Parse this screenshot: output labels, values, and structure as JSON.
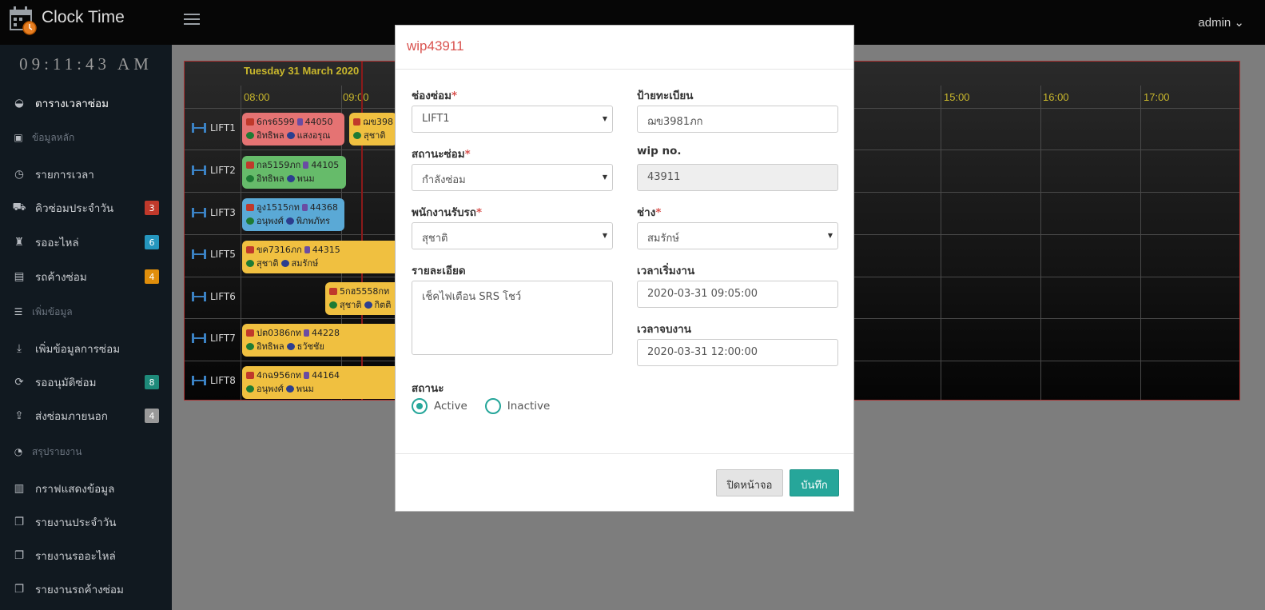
{
  "app": {
    "title": "Clock Time",
    "user": "admin ⌄"
  },
  "clock": "09:11:43 AM",
  "sidebar": {
    "items": [
      {
        "label": "ตารางเวลาซ่อม",
        "type": "item",
        "active": true
      },
      {
        "label": "ข้อมูลหลัก",
        "type": "header"
      },
      {
        "label": "รายการเวลา",
        "type": "item"
      },
      {
        "label": "คิวซ่อมประจำวัน",
        "type": "item",
        "badge": "3",
        "badge_color": "#c0392b"
      },
      {
        "label": "รออะไหล่",
        "type": "item",
        "badge": "6",
        "badge_color": "#2596be"
      },
      {
        "label": "รถค้างซ่อม",
        "type": "item",
        "badge": "4",
        "badge_color": "#e08e0b"
      },
      {
        "label": "เพิ่มข้อมูล",
        "type": "header"
      },
      {
        "label": "เพิ่มข้อมูลการซ่อม",
        "type": "item"
      },
      {
        "label": "รออนุมัติซ่อม",
        "type": "item",
        "badge": "8",
        "badge_color": "#1e8a7a"
      },
      {
        "label": "ส่งซ่อมภายนอก",
        "type": "item",
        "badge": "4",
        "badge_color": "#999999"
      },
      {
        "label": "สรุปรายงาน",
        "type": "header"
      },
      {
        "label": "กราฟแสดงข้อมูล",
        "type": "item"
      },
      {
        "label": "รายงานประจำวัน",
        "type": "item"
      },
      {
        "label": "รายงานรออะไหล่",
        "type": "item"
      },
      {
        "label": "รายงานรถค้างซ่อม",
        "type": "item"
      }
    ]
  },
  "schedule": {
    "date": "Tuesday 31 March 2020",
    "hours": [
      "08:00",
      "09:00",
      ":00",
      "15:00",
      "16:00",
      "17:00"
    ],
    "lifts": [
      "LIFT1",
      "LIFT2",
      "LIFT3",
      "LIFT5",
      "LIFT6",
      "LIFT7",
      "LIFT8"
    ],
    "jobs": [
      {
        "plate": "6กร6599",
        "wip": "44050",
        "staff": "อิทธิพล",
        "tech": "แสงอรุณ",
        "color": "#e57373"
      },
      {
        "plate": "ฌข398",
        "wip": "",
        "staff": "สุชาติ",
        "tech": "",
        "color": "#f0c040"
      },
      {
        "plate": "กล5159ภก",
        "wip": "44105",
        "staff": "อิทธิพล",
        "tech": "พนม",
        "color": "#66bb6a"
      },
      {
        "plate": "อูง1515กท",
        "wip": "44368",
        "staff": "อนุพงศ์",
        "tech": "พิภพภัทร",
        "color": "#5aa9d6"
      },
      {
        "plate": "ขค7316ภก",
        "wip": "44315",
        "staff": "สุชาติ",
        "tech": "สมรักษ์",
        "color": "#f0c040"
      },
      {
        "plate": "5กฮ5558กท",
        "wip": "",
        "staff": "สุชาติ",
        "tech": "กิตติ",
        "color": "#f0c040"
      },
      {
        "plate": "ปต0386กท",
        "wip": "44228",
        "staff": "อิทธิพล",
        "tech": "ธวัชชัย",
        "color": "#f0c040"
      },
      {
        "plate": "4กฉ956กท",
        "wip": "44164",
        "staff": "อนุพงศ์",
        "tech": "พนม",
        "color": "#f0c040"
      }
    ]
  },
  "modal": {
    "title": "wip43911",
    "fields": {
      "bay_label": "ช่องซ่อม",
      "bay_value": "LIFT1",
      "plate_label": "ป้ายทะเบียน",
      "plate_value": "ฌข3981ภก",
      "status_label": "สถานะซ่อม",
      "status_value": "กำลังซ่อม",
      "wip_label": "wip no.",
      "wip_value": "43911",
      "receiver_label": "พนักงานรับรถ",
      "receiver_value": "สุชาติ",
      "tech_label": "ช่าง",
      "tech_value": "สมรักษ์",
      "detail_label": "รายละเอียด",
      "detail_value": "เช็คไฟเตือน SRS โชว์",
      "start_label": "เวลาเริ่มงาน",
      "start_value": "2020-03-31 09:05:00",
      "end_label": "เวลาจบงาน",
      "end_value": "2020-03-31 12:00:00",
      "state_label": "สถานะ",
      "active_label": "Active",
      "inactive_label": "Inactive"
    },
    "close_label": "ปิดหน้าจอ",
    "save_label": "บันทึก"
  }
}
